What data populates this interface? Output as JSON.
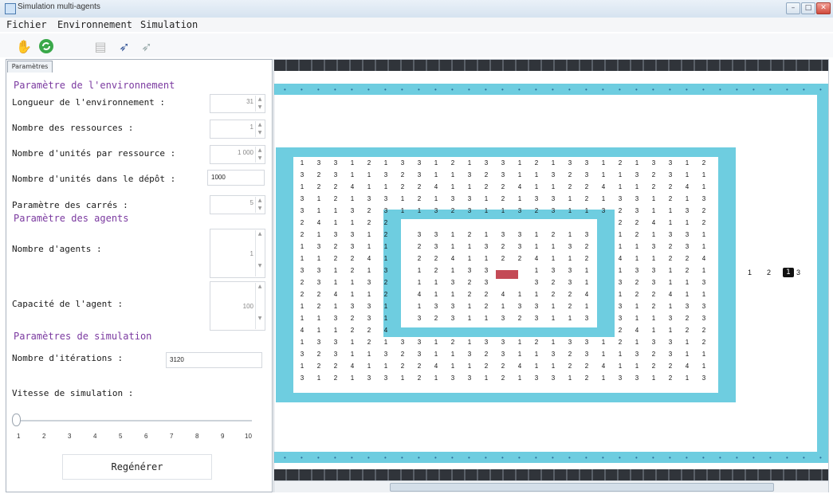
{
  "window": {
    "title": "Simulation multi-agents",
    "min": "–",
    "max": "□",
    "close": "✕"
  },
  "menu": [
    "Fichier",
    "Environnement",
    "Simulation"
  ],
  "toolbar": {
    "icons": [
      "hand-icon",
      "refresh-icon",
      "document-icon",
      "bird-icon",
      "bird-gray-icon"
    ]
  },
  "panel": {
    "tab_label": "Paramètres",
    "env_section": "Paramètre de l'environnement",
    "env_length_label": "Longueur de l'environnement :",
    "env_length_value": "31",
    "resources_label": "Nombre des ressources :",
    "resources_value": "1",
    "units_per_resource_label": "Nombre d'unités par ressource :",
    "units_per_resource_value": "1 000",
    "units_depot_label": "Nombre d'unités dans le dépôt :",
    "units_depot_value": "1000",
    "squares_label": "Paramètre des carrés :",
    "squares_value": "5",
    "agents_section": "Paramètre des agents",
    "agents_count_label": "Nombre d'agents :",
    "agents_count_value": "1",
    "agent_capacity_label": "Capacité de l'agent :",
    "agent_capacity_value": "100",
    "sim_section": "Paramètres de simulation",
    "iterations_label": "Nombre d'itérations :",
    "iterations_value": "3120",
    "speed_label": "Vitesse de simulation :",
    "speed_ticks": [
      "1",
      "2",
      "3",
      "4",
      "5",
      "6",
      "7",
      "8",
      "9",
      "10"
    ],
    "speed_value": 1,
    "regen_label": "Regénérer"
  },
  "legend": {
    "items": [
      "1",
      "2"
    ],
    "selected": "1",
    "after": "3"
  }
}
